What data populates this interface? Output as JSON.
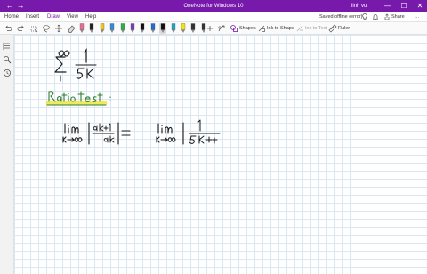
{
  "titlebar": {
    "title": "OneNote for Windows 10",
    "user": "linh vu",
    "back": "←",
    "forward": "→",
    "minimize": "—",
    "maximize": "☐",
    "close": "✕"
  },
  "tabs": [
    {
      "label": "Home"
    },
    {
      "label": "Insert"
    },
    {
      "label": "Draw"
    },
    {
      "label": "View"
    },
    {
      "label": "Help"
    }
  ],
  "tabbar_right": {
    "status": "Saved offline (error)",
    "share": "Share",
    "more": "…"
  },
  "toolbar": {
    "shapes": "Shapes",
    "ink_to_shape": "Ink to Shape",
    "ink_to_text": "Ink to Text",
    "ruler": "Ruler",
    "pens": [
      {
        "color": "#e86b9a"
      },
      {
        "color": "#222222"
      },
      {
        "color": "#f0c419"
      },
      {
        "color": "#2e8ddb"
      },
      {
        "color": "#2bb14a"
      },
      {
        "color": "#7a3fb6"
      },
      {
        "color": "#111111"
      },
      {
        "color": "#1f6fd0"
      },
      {
        "color": "#111111"
      },
      {
        "color": "#1fa6c7"
      },
      {
        "color": "#f4e01b"
      },
      {
        "color": "#333333"
      },
      {
        "color": "#333333"
      }
    ]
  },
  "colors": {
    "accent": "#7719aa",
    "ink_black": "#1a1a1a",
    "ink_green": "#2e7d32",
    "highlight": "#f2e84a"
  }
}
